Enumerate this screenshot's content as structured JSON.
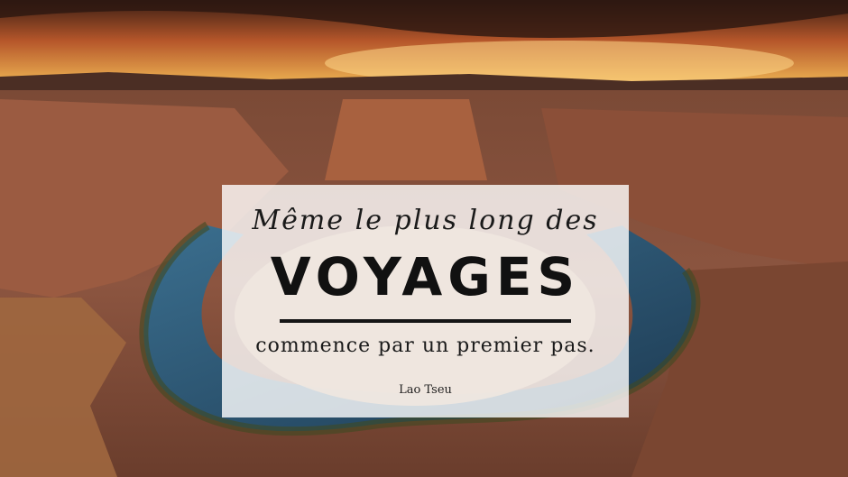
{
  "quote": {
    "line1": "Même le plus long des",
    "line2": "VOYAGES",
    "line3": "commence par un premier pas.",
    "author": "Lao Tseu"
  },
  "colors": {
    "sky_top": "#3a1e14",
    "sky_glow": "#f3a63a",
    "rock": "#8a4f38",
    "river": "#2f5b78",
    "overlay": "#ffffff"
  }
}
